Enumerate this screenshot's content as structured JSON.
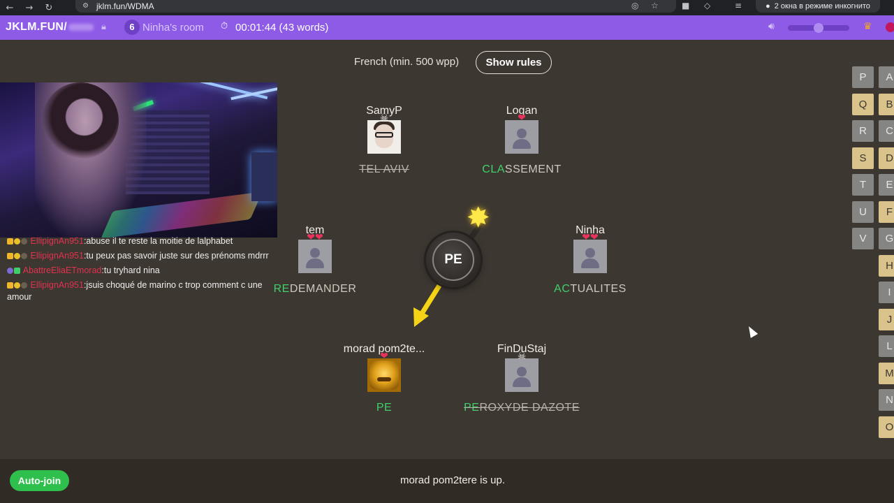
{
  "browser": {
    "url": "jklm.fun/WDMA",
    "incognito_label": "2 окна в режиме инкогнито"
  },
  "topbar": {
    "site": "JKLM.FUN/",
    "player_count": "6",
    "room_name": "Ninha's room",
    "timer": "00:01:44 (43 words)",
    "volume_level": 0.5
  },
  "rules": {
    "language": "French (min. 500 wpp)",
    "show_rules_label": "Show rules"
  },
  "chat": [
    {
      "author": "EllipignAn951",
      "text": "abuse il te reste la moitie de lalphabet"
    },
    {
      "author": "EllipignAn951",
      "text": "tu peux pas savoir juste sur des prénoms mdrrr"
    },
    {
      "author": "AbattreEliaETmorad",
      "text": "tu tryhard nina"
    },
    {
      "author": "EllipignAn951",
      "text": "jsuis choqué de marino c trop comment c une amour"
    }
  ],
  "players": [
    {
      "name": "SamyP",
      "status": "☠",
      "word_hl": "",
      "word_rest": "TEL AVIV",
      "dead": true
    },
    {
      "name": "Logan",
      "status": "❤",
      "word_hl": "CLA",
      "word_rest": "SSEMENT",
      "dead": false
    },
    {
      "name": "tem",
      "status": "❤❤",
      "word_hl": "RE",
      "word_rest": "DEMANDER",
      "dead": false
    },
    {
      "name": "Ninha",
      "status": "❤❤",
      "word_hl": "AC",
      "word_rest": "TUALITES",
      "dead": false
    },
    {
      "name": "morad pom2te...",
      "status": "❤",
      "word_hl": "PE",
      "word_rest": "",
      "dead": false
    },
    {
      "name": "FinDuStaj",
      "status": "☠",
      "word_hl": "PE",
      "word_rest": "ROXYDE DAZOTE",
      "dead": true
    }
  ],
  "bomb": {
    "syllable": "PE"
  },
  "letters": {
    "col1": [
      {
        "l": "P",
        "on": false
      },
      {
        "l": "Q",
        "on": true
      },
      {
        "l": "R",
        "on": false
      },
      {
        "l": "S",
        "on": true
      },
      {
        "l": "T",
        "on": false
      },
      {
        "l": "U",
        "on": false
      },
      {
        "l": "V",
        "on": false
      }
    ],
    "col2": [
      {
        "l": "A",
        "on": false
      },
      {
        "l": "B",
        "on": true
      },
      {
        "l": "C",
        "on": false
      },
      {
        "l": "D",
        "on": true
      },
      {
        "l": "E",
        "on": false
      },
      {
        "l": "F",
        "on": true
      },
      {
        "l": "G",
        "on": false
      },
      {
        "l": "H",
        "on": true
      },
      {
        "l": "I",
        "on": false
      },
      {
        "l": "J",
        "on": true
      },
      {
        "l": "L",
        "on": false
      },
      {
        "l": "M",
        "on": true
      },
      {
        "l": "N",
        "on": false
      },
      {
        "l": "O",
        "on": true
      }
    ]
  },
  "bottom": {
    "auto_join_label": "Auto-join",
    "status": "morad pom2tere is up."
  },
  "colors": {
    "accent": "#8e5be7",
    "background": "#3d3731",
    "highlight": "#3fd16b",
    "heart": "#e8345d"
  },
  "icons": {
    "lock": "lock-icon",
    "timer": "timer-icon",
    "volume": "volume-icon",
    "crown": "crown-icon",
    "spark": "spark-icon"
  }
}
